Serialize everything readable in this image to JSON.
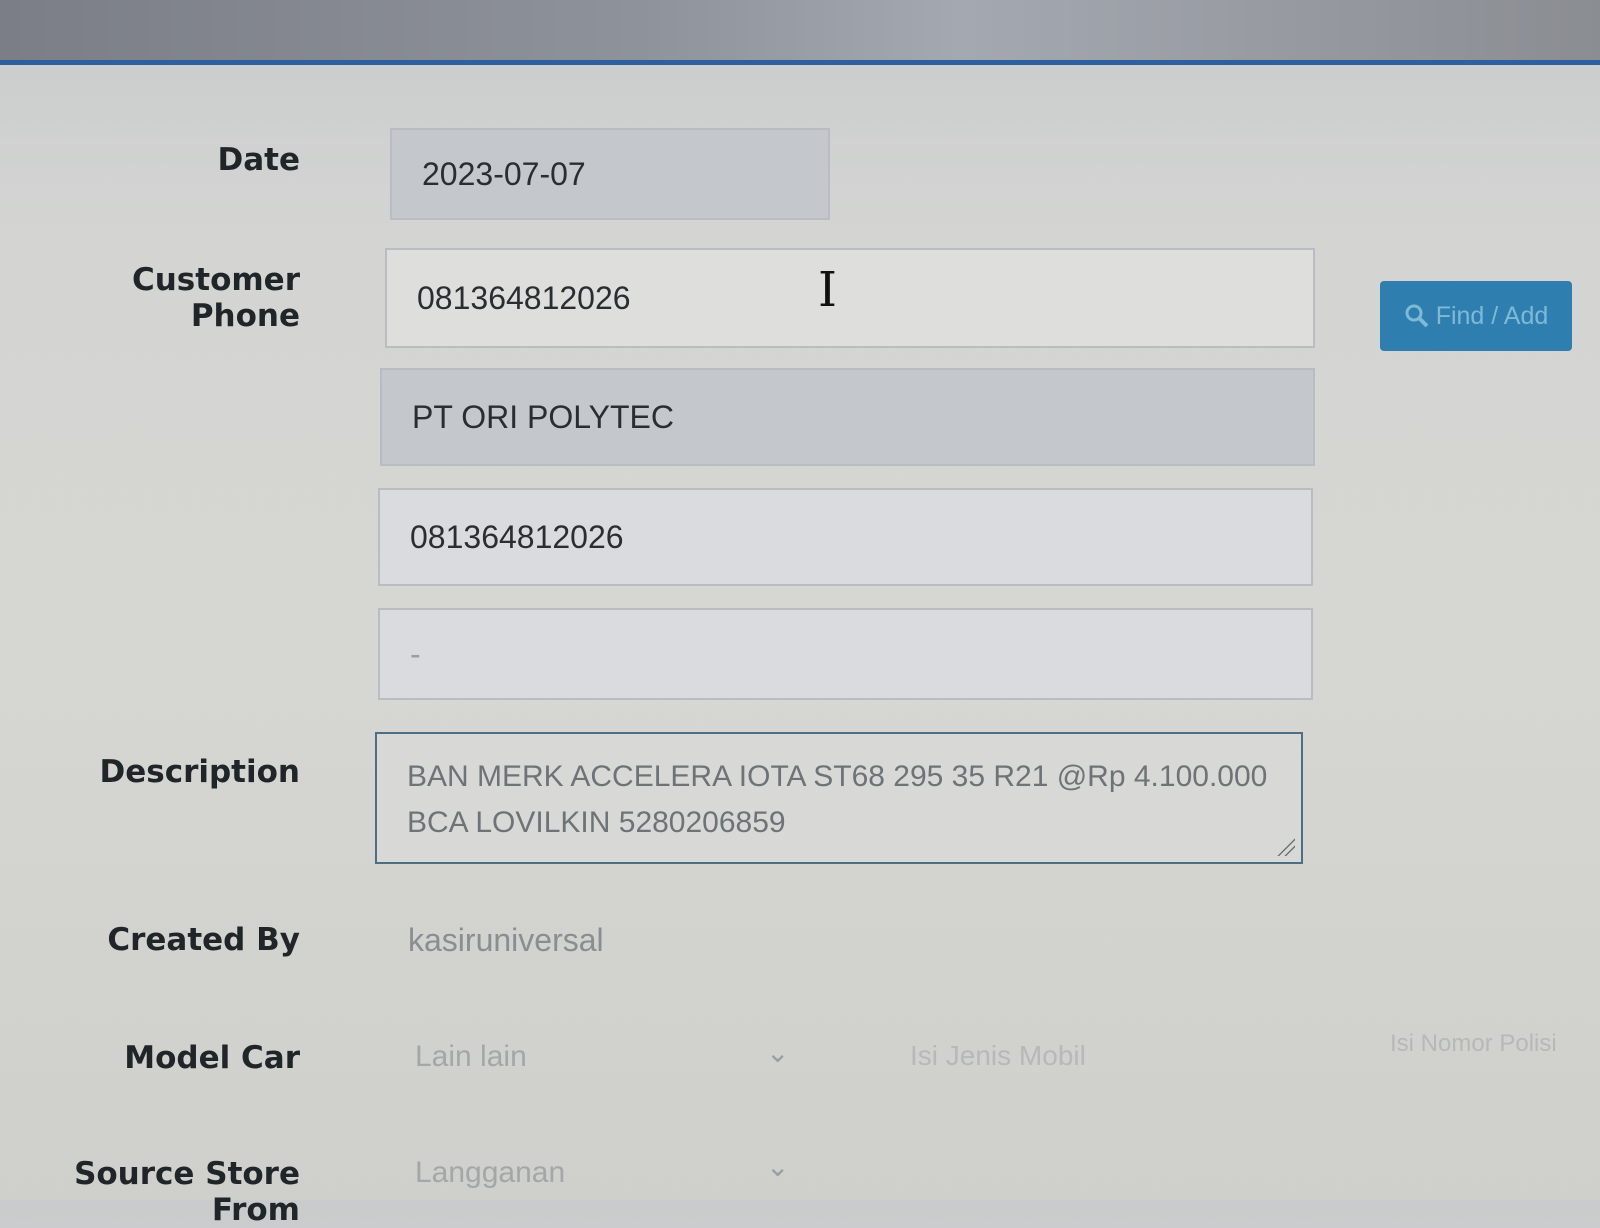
{
  "form": {
    "date": {
      "label": "Date",
      "value": "2023-07-07"
    },
    "customer_phone": {
      "label": "Customer Phone",
      "value": "081364812026"
    },
    "find_add_label": "Find / Add",
    "customer_name": "PT ORI POLYTEC",
    "customer_phone_2": "081364812026",
    "customer_extra": "-",
    "description": {
      "label": "Description",
      "line1": "BAN MERK ACCELERA IOTA ST68 295 35 R21 @Rp 4.100.000",
      "line2": "BCA LOVILKIN 5280206859"
    },
    "created_by": {
      "label": "Created By",
      "value": "kasiruniversal"
    },
    "model_car": {
      "label": "Model Car",
      "value": "Lain lain",
      "extra_placeholder": "Isi Jenis Mobil",
      "extra_right": "Isi Nomor Polisi"
    },
    "source_store": {
      "label": "Source Store From",
      "value": "Langganan"
    }
  },
  "colors": {
    "button": "#2e7fb0",
    "header_rule": "#2f5f9e"
  },
  "icons": {
    "find": "search-icon",
    "select": "chevron-down-icon"
  }
}
